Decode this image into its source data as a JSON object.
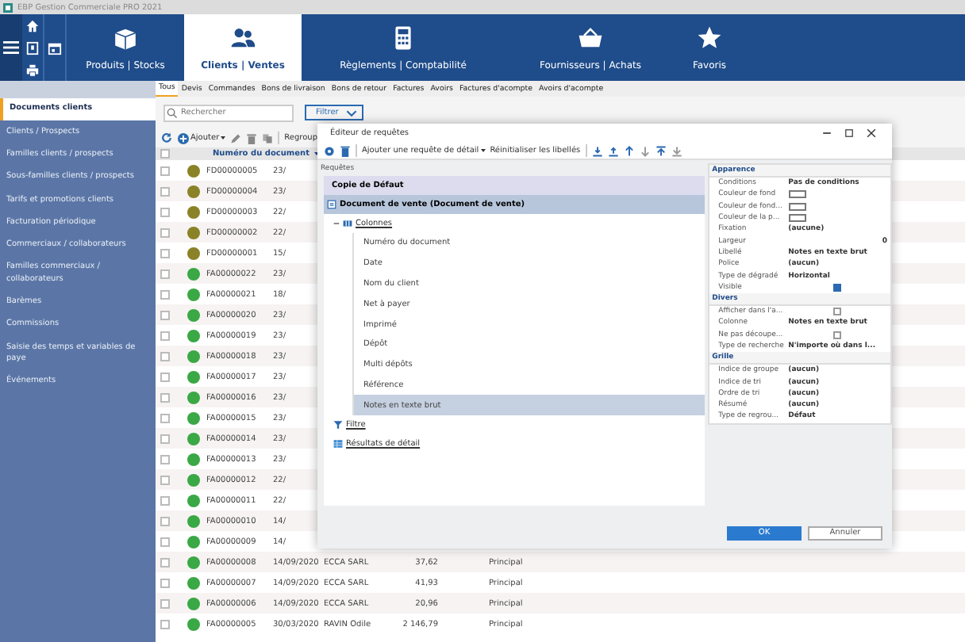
{
  "window": {
    "title": "EBP Gestion Commerciale PRO 2021"
  },
  "nav_tabs": [
    {
      "label": "Produits | Stocks",
      "selected": false
    },
    {
      "label": "Clients | Ventes",
      "selected": true
    },
    {
      "label": "Règlements | Comptabilité",
      "selected": false
    },
    {
      "label": "Fournisseurs | Achats",
      "selected": false
    },
    {
      "label": "Favoris",
      "selected": false
    }
  ],
  "sidebar": {
    "items": [
      {
        "label": "Documents clients",
        "selected": true
      },
      {
        "label": "Clients / Prospects",
        "selected": false
      },
      {
        "label": "Familles clients / prospects",
        "selected": false
      },
      {
        "label": "Sous-familles clients / prospects",
        "selected": false
      },
      {
        "label": "Tarifs et promotions clients",
        "selected": false
      },
      {
        "label": "Facturation périodique",
        "selected": false
      },
      {
        "label": "Commerciaux / collaborateurs",
        "selected": false
      },
      {
        "label": "Familles commerciaux / collaborateurs",
        "selected": false
      },
      {
        "label": "Barèmes",
        "selected": false
      },
      {
        "label": "Commissions",
        "selected": false
      },
      {
        "label": "Saisie des temps et variables de paye",
        "selected": false
      },
      {
        "label": "Événements",
        "selected": false
      }
    ]
  },
  "doc_tabs": [
    {
      "label": "Tous",
      "selected": true
    },
    {
      "label": "Devis",
      "selected": false
    },
    {
      "label": "Commandes",
      "selected": false
    },
    {
      "label": "Bons de livraison",
      "selected": false
    },
    {
      "label": "Bons de retour",
      "selected": false
    },
    {
      "label": "Factures",
      "selected": false
    },
    {
      "label": "Avoirs",
      "selected": false
    },
    {
      "label": "Factures d'acompte",
      "selected": false
    },
    {
      "label": "Avoirs d'acompte",
      "selected": false
    }
  ],
  "search": {
    "placeholder": "Rechercher"
  },
  "filter": {
    "label": "Filtrer"
  },
  "toolbar": {
    "add": "Ajouter",
    "group": "Regroup"
  },
  "table": {
    "columns": [
      "Numéro du document"
    ],
    "select_all": {
      "checked": false
    },
    "rows": [
      {
        "checked": false,
        "number": "FD00000005",
        "color": "#8a8226",
        "date": "23/"
      },
      {
        "checked": false,
        "number": "FD00000004",
        "color": "#8a8226",
        "date": "23/"
      },
      {
        "checked": false,
        "number": "FD00000003",
        "color": "#8a8226",
        "date": "22/"
      },
      {
        "checked": false,
        "number": "FD00000002",
        "color": "#8a8226",
        "date": "22/"
      },
      {
        "checked": false,
        "number": "FD00000001",
        "color": "#8a8226",
        "date": "15/"
      },
      {
        "checked": false,
        "number": "FA00000022",
        "color": "#3aa845",
        "date": "23/"
      },
      {
        "checked": false,
        "number": "FA00000021",
        "color": "#3aa845",
        "date": "18/"
      },
      {
        "checked": false,
        "number": "FA00000020",
        "color": "#3aa845",
        "date": "23/"
      },
      {
        "checked": false,
        "number": "FA00000019",
        "color": "#3aa845",
        "date": "23/"
      },
      {
        "checked": false,
        "number": "FA00000018",
        "color": "#3aa845",
        "date": "23/"
      },
      {
        "checked": false,
        "number": "FA00000017",
        "color": "#3aa845",
        "date": "23/"
      },
      {
        "checked": false,
        "number": "FA00000016",
        "color": "#3aa845",
        "date": "23/"
      },
      {
        "checked": false,
        "number": "FA00000015",
        "color": "#3aa845",
        "date": "23/"
      },
      {
        "checked": false,
        "number": "FA00000014",
        "color": "#3aa845",
        "date": "23/"
      },
      {
        "checked": false,
        "number": "FA00000013",
        "color": "#3aa845",
        "date": "23/"
      },
      {
        "checked": false,
        "number": "FA00000012",
        "color": "#3aa845",
        "date": "22/"
      },
      {
        "checked": false,
        "number": "FA00000011",
        "color": "#3aa845",
        "date": "22/"
      },
      {
        "checked": false,
        "number": "FA00000010",
        "color": "#3aa845",
        "date": "14/"
      },
      {
        "checked": false,
        "number": "FA00000009",
        "color": "#3aa845",
        "date": "14/"
      },
      {
        "checked": false,
        "number": "FA00000008",
        "color": "#3aa845",
        "date": "14/09/2020",
        "client": "ECCA SARL",
        "amount": "37,62",
        "depot": "Principal"
      },
      {
        "checked": false,
        "number": "FA00000007",
        "color": "#3aa845",
        "date": "14/09/2020",
        "client": "ECCA SARL",
        "amount": "41,93",
        "depot": "Principal"
      },
      {
        "checked": false,
        "number": "FA00000006",
        "color": "#3aa845",
        "date": "14/09/2020",
        "client": "ECCA SARL",
        "amount": "20,96",
        "depot": "Principal"
      },
      {
        "checked": false,
        "number": "FA00000005",
        "color": "#3aa845",
        "date": "30/03/2020",
        "client": "RAVIN Odile",
        "amount": "2 146,79",
        "depot": "Principal"
      }
    ]
  },
  "dialog": {
    "title": "Éditeur de requêtes",
    "toolbar": {
      "add_detail": "Ajouter une requête de détail",
      "reset": "Réinitialiser les libellés"
    },
    "section_label": "Requêtes",
    "query": "Copie de Défaut",
    "root": "Document de vente (Document de vente)",
    "tree": [
      {
        "label": "Colonnes",
        "kind": "columns",
        "expanded": true,
        "children": [
          {
            "label": "Numéro du document",
            "selected": false
          },
          {
            "label": "Date",
            "selected": false
          },
          {
            "label": "Nom du client",
            "selected": false
          },
          {
            "label": "Net à payer",
            "selected": false
          },
          {
            "label": "Imprimé",
            "selected": false
          },
          {
            "label": "Dépôt",
            "selected": false
          },
          {
            "label": "Multi dépôts",
            "selected": false
          },
          {
            "label": "Référence",
            "selected": false
          },
          {
            "label": "Notes en texte brut",
            "selected": true
          }
        ]
      },
      {
        "label": "Filtre",
        "kind": "filter"
      },
      {
        "label": "Résultats de détail",
        "kind": "details"
      }
    ],
    "properties": [
      {
        "section": "Apparence",
        "rows": [
          {
            "name": "Conditions",
            "kind": "text",
            "value": "Pas de conditions"
          },
          {
            "name": "Couleur de fond",
            "kind": "swatch"
          },
          {
            "name": "Couleur de fond...",
            "kind": "swatch"
          },
          {
            "name": "Couleur de la p...",
            "kind": "swatch"
          },
          {
            "name": "Fixation",
            "kind": "text",
            "value": "(aucune)"
          },
          {
            "name": "Largeur",
            "kind": "number",
            "value": "0"
          },
          {
            "name": "Libellé",
            "kind": "text",
            "value": "Notes en texte brut"
          },
          {
            "name": "Police",
            "kind": "text",
            "value": "(aucun)"
          },
          {
            "name": "Type de dégradé",
            "kind": "text",
            "value": "Horizontal"
          },
          {
            "name": "Visible",
            "kind": "checkbox",
            "checked": true
          }
        ]
      },
      {
        "section": "Divers",
        "rows": [
          {
            "name": "Afficher dans l'a...",
            "kind": "checkbox",
            "checked": false
          },
          {
            "name": "Colonne",
            "kind": "text",
            "value": "Notes en texte brut"
          },
          {
            "name": "Ne pas découpe...",
            "kind": "checkbox",
            "checked": false
          },
          {
            "name": "Type de recherche",
            "kind": "text",
            "value": "N'importe où dans l..."
          }
        ]
      },
      {
        "section": "Grille",
        "rows": [
          {
            "name": "Indice de groupe",
            "kind": "text",
            "value": "(aucun)"
          },
          {
            "name": "Indice de tri",
            "kind": "text",
            "value": "(aucun)"
          },
          {
            "name": "Ordre de tri",
            "kind": "text",
            "value": "(aucun)"
          },
          {
            "name": "Résumé",
            "kind": "text",
            "value": "(aucun)"
          },
          {
            "name": "Type de regrou...",
            "kind": "text",
            "value": "Défaut"
          }
        ]
      }
    ],
    "buttons": [
      {
        "label": "OK",
        "primary": true
      },
      {
        "label": "Annuler",
        "primary": false
      }
    ]
  }
}
